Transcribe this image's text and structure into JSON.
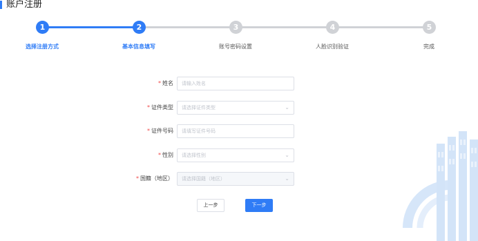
{
  "page": {
    "title": "账户注册"
  },
  "colors": {
    "accent": "#2f7cf6",
    "inactive": "#d0d2d6",
    "required": "#f04848",
    "watermark": "#d6e6f9"
  },
  "steps": [
    {
      "number": "1",
      "label": "选择注册方式",
      "state": "done"
    },
    {
      "number": "2",
      "label": "基本信息填写",
      "state": "active"
    },
    {
      "number": "3",
      "label": "账号密码设置",
      "state": "pending"
    },
    {
      "number": "4",
      "label": "人脸识别验证",
      "state": "pending"
    },
    {
      "number": "5",
      "label": "完成",
      "state": "pending"
    }
  ],
  "form": {
    "required_mark": "*",
    "fields": [
      {
        "label": "姓名",
        "placeholder": "请输入姓名",
        "type": "text"
      },
      {
        "label": "证件类型",
        "placeholder": "请选择证件类型",
        "type": "select"
      },
      {
        "label": "证件号码",
        "placeholder": "请填写证件号码",
        "type": "text"
      },
      {
        "label": "性别",
        "placeholder": "请选择性别",
        "type": "select"
      },
      {
        "label": "国籍（地区）",
        "placeholder": "请选择国籍（地区）",
        "type": "select-disabled"
      }
    ],
    "chevron_icon": "chevron-down-icon"
  },
  "buttons": {
    "prev_label": "上一步",
    "next_label": "下一步"
  }
}
